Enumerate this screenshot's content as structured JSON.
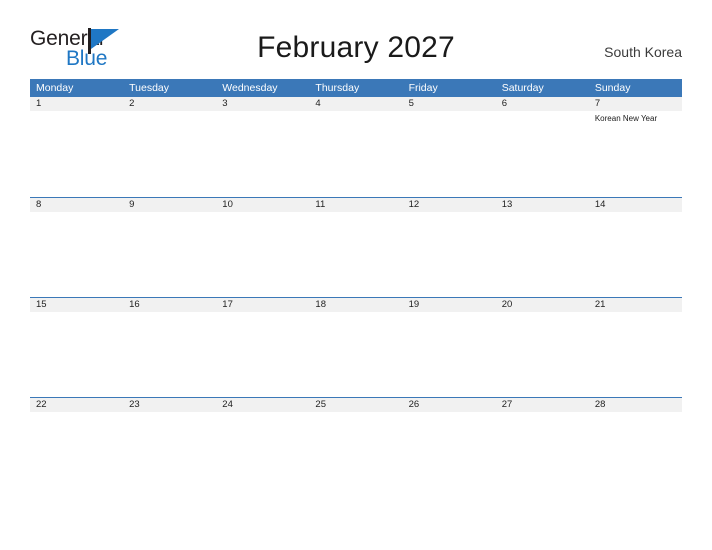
{
  "brand": {
    "name_part1": "General",
    "name_part2": "Blue"
  },
  "header": {
    "title": "February 2027",
    "country": "South Korea"
  },
  "colors": {
    "header_blue": "#3b78b8",
    "band_gray": "#f1f1f1",
    "logo_blue": "#1f77c4",
    "text_dark": "#231f20"
  },
  "calendar": {
    "weekdays": [
      "Monday",
      "Tuesday",
      "Wednesday",
      "Thursday",
      "Friday",
      "Saturday",
      "Sunday"
    ],
    "weeks": [
      {
        "days": [
          {
            "date": "1",
            "events": []
          },
          {
            "date": "2",
            "events": []
          },
          {
            "date": "3",
            "events": []
          },
          {
            "date": "4",
            "events": []
          },
          {
            "date": "5",
            "events": []
          },
          {
            "date": "6",
            "events": []
          },
          {
            "date": "7",
            "events": [
              "Korean New Year"
            ]
          }
        ]
      },
      {
        "days": [
          {
            "date": "8",
            "events": []
          },
          {
            "date": "9",
            "events": []
          },
          {
            "date": "10",
            "events": []
          },
          {
            "date": "11",
            "events": []
          },
          {
            "date": "12",
            "events": []
          },
          {
            "date": "13",
            "events": []
          },
          {
            "date": "14",
            "events": []
          }
        ]
      },
      {
        "days": [
          {
            "date": "15",
            "events": []
          },
          {
            "date": "16",
            "events": []
          },
          {
            "date": "17",
            "events": []
          },
          {
            "date": "18",
            "events": []
          },
          {
            "date": "19",
            "events": []
          },
          {
            "date": "20",
            "events": []
          },
          {
            "date": "21",
            "events": []
          }
        ]
      },
      {
        "days": [
          {
            "date": "22",
            "events": []
          },
          {
            "date": "23",
            "events": []
          },
          {
            "date": "24",
            "events": []
          },
          {
            "date": "25",
            "events": []
          },
          {
            "date": "26",
            "events": []
          },
          {
            "date": "27",
            "events": []
          },
          {
            "date": "28",
            "events": []
          }
        ]
      }
    ]
  }
}
